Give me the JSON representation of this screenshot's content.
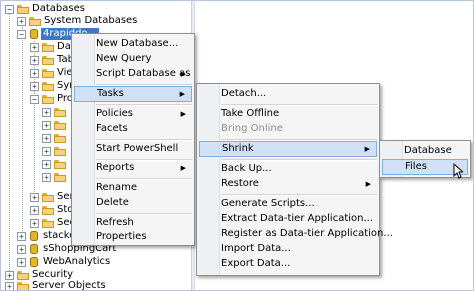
{
  "tree": {
    "databases": "Databases",
    "system_databases": "System Databases",
    "selected_db": "4rapiddo...",
    "children_partial": [
      "Dat",
      "Tab",
      "View",
      "Syn",
      "Pro"
    ],
    "lower_partial": [
      "Serv",
      "Sto",
      "Sec"
    ],
    "other_dbs": [
      "stackov",
      "sShoppingCart",
      "WebAnalytics"
    ],
    "security": "Security",
    "server_objects": "Server Objects"
  },
  "context_menu": {
    "items": [
      "New Database...",
      "New Query",
      "Script Database as",
      "Tasks",
      "Policies",
      "Facets",
      "Start PowerShell",
      "Reports",
      "Rename",
      "Delete",
      "Refresh",
      "Properties"
    ]
  },
  "tasks_menu": {
    "items": [
      "Detach...",
      "Take Offline",
      "Bring Online",
      "Shrink",
      "Back Up...",
      "Restore",
      "Generate Scripts...",
      "Extract Data-tier Application...",
      "Register as Data-tier Application...",
      "Import Data...",
      "Export Data..."
    ]
  },
  "shrink_menu": {
    "items": [
      "Database",
      "Files"
    ]
  },
  "icons": {
    "expand": "plus-box-icon",
    "collapse": "minus-box-icon",
    "submenu": "chevron-right-icon"
  },
  "colors": {
    "selection": "#3b79c3",
    "highlight": "#cfe0f7",
    "folder": "#f3d27a"
  }
}
